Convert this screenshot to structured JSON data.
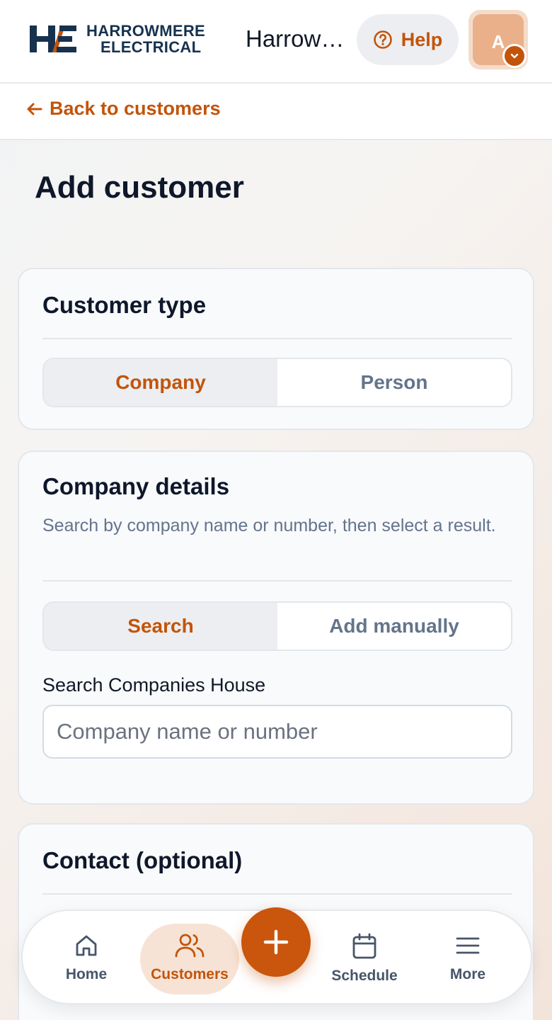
{
  "header": {
    "logo": {
      "monogram": "HE",
      "line1": "HARROWMERE",
      "line2": "ELECTRICAL"
    },
    "workspace_name": "Harrowmere Electrical",
    "help_label": "Help",
    "avatar_initial": "A"
  },
  "backbar": {
    "back_label": "Back to customers"
  },
  "page": {
    "title": "Add customer"
  },
  "customer_type": {
    "title": "Customer type",
    "options": [
      "Company",
      "Person"
    ],
    "selected": "Company"
  },
  "company_details": {
    "title": "Company details",
    "description": "Search by company name or number, then select a result.",
    "mode_options": [
      "Search",
      "Add manually"
    ],
    "selected_mode": "Search",
    "search_label": "Search Companies House",
    "search_placeholder": "Company name or number",
    "search_value": ""
  },
  "contact": {
    "title": "Contact (optional)"
  },
  "bottom_nav": {
    "items": [
      {
        "label": "Home",
        "icon": "home-icon",
        "active": false
      },
      {
        "label": "Customers",
        "icon": "users-icon",
        "active": true
      },
      {
        "label": "Schedule",
        "icon": "calendar-icon",
        "active": false
      },
      {
        "label": "More",
        "icon": "menu-icon",
        "active": false
      }
    ],
    "fab_icon": "plus-icon"
  },
  "colors": {
    "accent": "#c2540a",
    "brand_navy": "#16324f"
  }
}
